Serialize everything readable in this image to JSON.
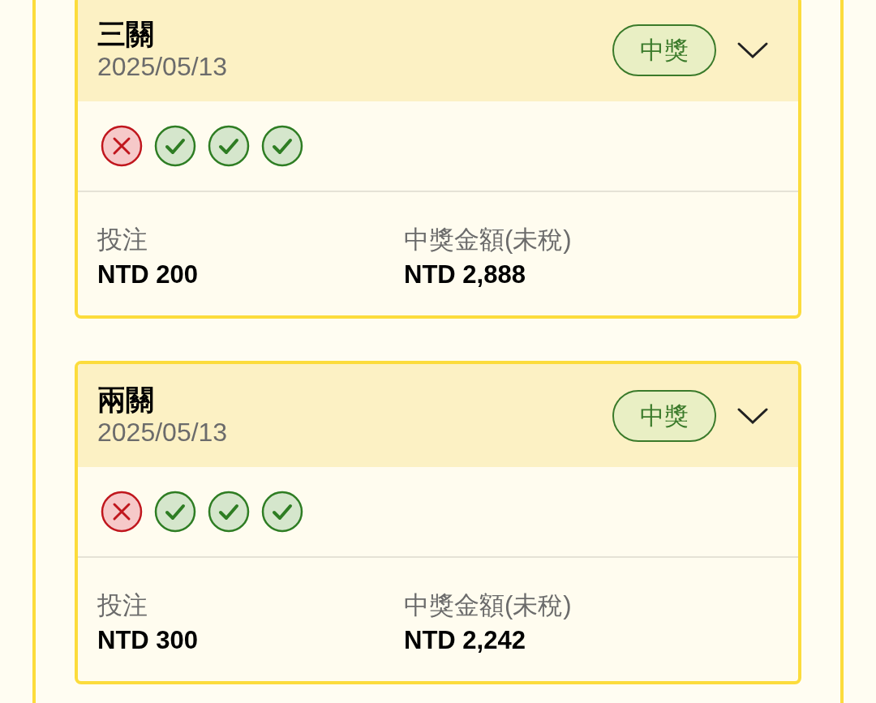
{
  "bets": [
    {
      "title": "三關",
      "date": "2025/05/13",
      "badge": "中獎",
      "expanded": false,
      "legs": [
        {
          "kind": "miss"
        },
        {
          "kind": "hit"
        },
        {
          "kind": "hit"
        },
        {
          "kind": "hit"
        }
      ],
      "stake_label": "投注",
      "stake": "NTD 200",
      "prize_label": "中獎金額(未稅)",
      "prize": "NTD 2,888"
    },
    {
      "title": "兩關",
      "date": "2025/05/13",
      "badge": "中獎",
      "expanded": false,
      "legs": [
        {
          "kind": "miss"
        },
        {
          "kind": "hit"
        },
        {
          "kind": "hit"
        },
        {
          "kind": "hit"
        }
      ],
      "stake_label": "投注",
      "stake": "NTD 300",
      "prize_label": "中獎金額(未稅)",
      "prize": "NTD 2,242"
    }
  ]
}
